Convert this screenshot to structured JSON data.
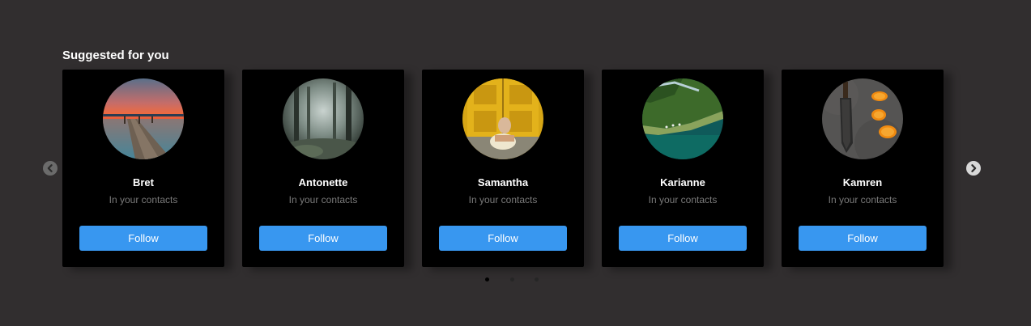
{
  "section": {
    "title": "Suggested for you"
  },
  "cards": [
    {
      "name": "Bret",
      "subtitle": "In your contacts",
      "button": "Follow",
      "avatar": "pier-sunset-photo"
    },
    {
      "name": "Antonette",
      "subtitle": "In your contacts",
      "button": "Follow",
      "avatar": "misty-forest-photo"
    },
    {
      "name": "Samantha",
      "subtitle": "In your contacts",
      "button": "Follow",
      "avatar": "yellow-door-portrait-photo"
    },
    {
      "name": "Karianne",
      "subtitle": "In your contacts",
      "button": "Follow",
      "avatar": "fjord-aerial-photo"
    },
    {
      "name": "Kamren",
      "subtitle": "In your contacts",
      "button": "Follow",
      "avatar": "knife-and-oranges-photo"
    }
  ],
  "carousel": {
    "prev_icon": "chevron-left-icon",
    "next_icon": "chevron-right-icon",
    "page_count": 3,
    "active_page": 1
  },
  "colors": {
    "background": "#312e2f",
    "card": "#000000",
    "button": "#3897f0",
    "subtitle": "#7a7a7a"
  }
}
